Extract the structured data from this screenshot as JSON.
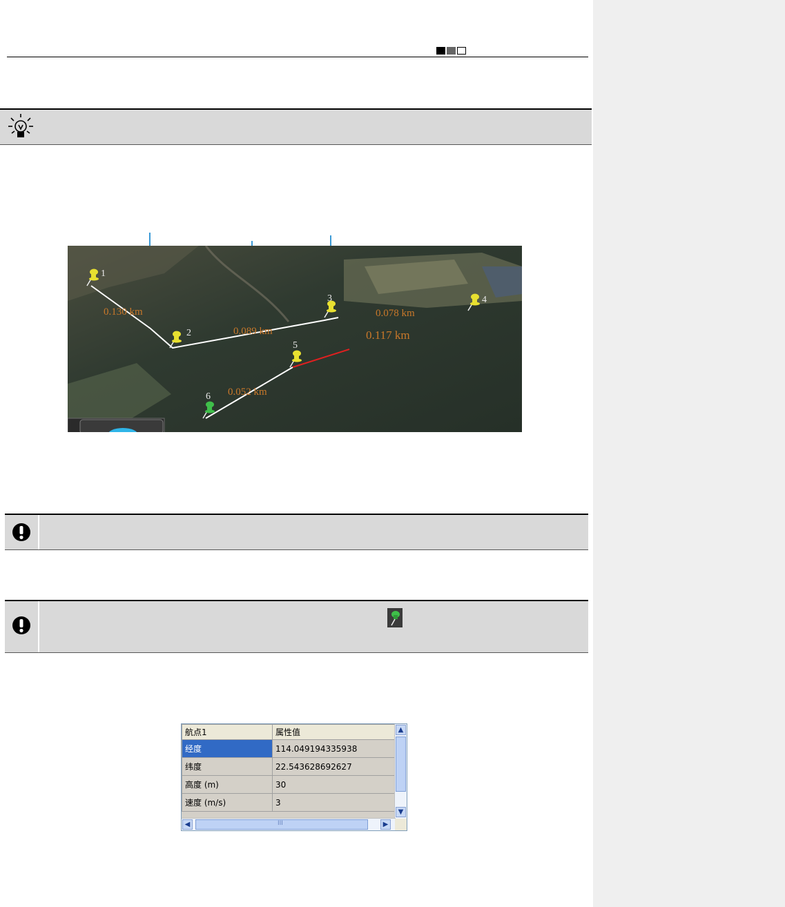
{
  "header": {
    "squares": [
      "black",
      "gray",
      "white"
    ]
  },
  "map": {
    "waypoints": [
      {
        "label": "1",
        "color": "#e8e030"
      },
      {
        "label": "2",
        "color": "#e8e030"
      },
      {
        "label": "3",
        "color": "#e8e030"
      },
      {
        "label": "4",
        "color": "#e8e030"
      },
      {
        "label": "5",
        "color": "#e8e030"
      },
      {
        "label": "6",
        "color": "#3fbf4a"
      }
    ],
    "distances": [
      "0.130 km",
      "0.089 km",
      "0.078 km",
      "0.117 km",
      "0.052 km"
    ],
    "label_color": "#c9782a",
    "path_color": "#ffffff",
    "active_segment_color": "#e02020"
  },
  "property_grid": {
    "header": [
      "航点1",
      "属性值"
    ],
    "rows": [
      {
        "name": "经度",
        "value": "114.049194335938",
        "selected": true
      },
      {
        "name": "纬度",
        "value": "22.543628692627"
      },
      {
        "name": "高度 (m)",
        "value": "30"
      },
      {
        "name": "速度 (m/s)",
        "value": "3"
      }
    ],
    "hscroll_grip": "III"
  },
  "icons": {
    "tip": "lightbulb-icon",
    "note": "exclamation-icon",
    "inline": "green-pin-icon"
  }
}
